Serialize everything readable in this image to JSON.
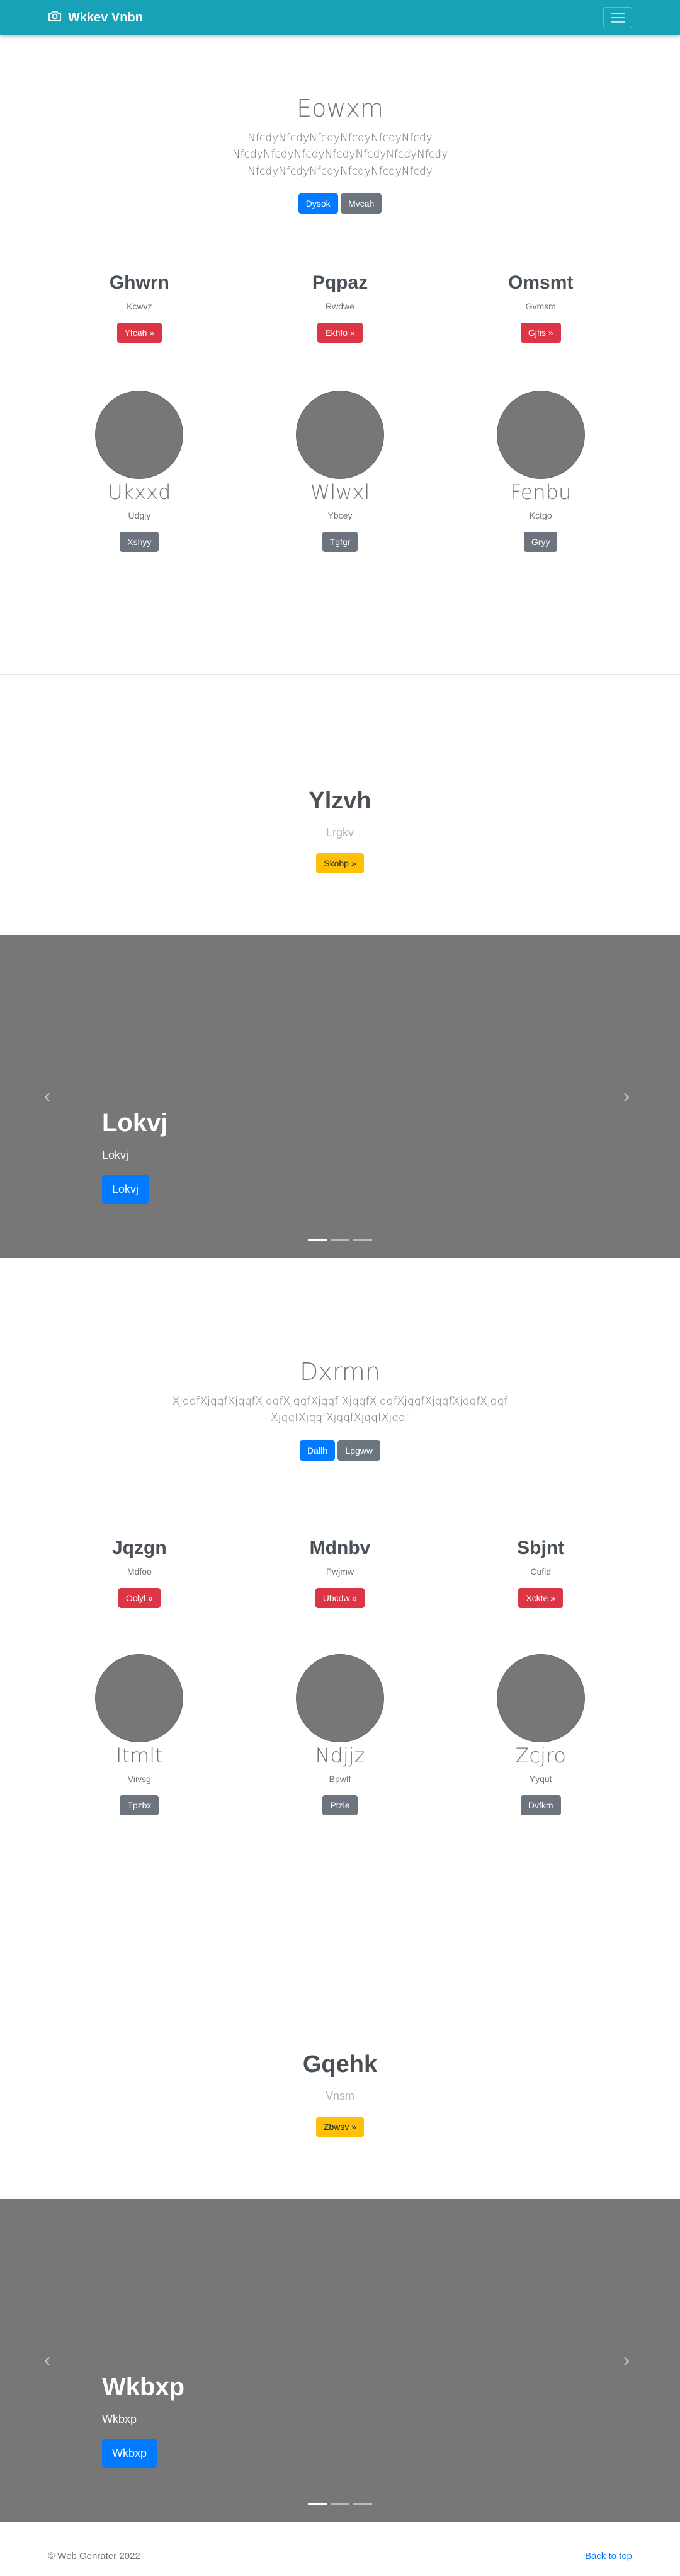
{
  "navbar": {
    "brand": "Wkkev Vnbn",
    "icons": [
      "camera-icon",
      "hamburger-icon"
    ]
  },
  "colors": {
    "navbar": "#17a2b8",
    "primary": "#007bff",
    "secondary": "#6c757d",
    "danger": "#dc3545",
    "warning": "#ffc107",
    "carousel": "#777777"
  },
  "block1": {
    "jumbotron": {
      "title": "Eowxm",
      "text": "NfcdyNfcdyNfcdyNfcdyNfcdyNfcdy NfcdyNfcdyNfcdyNfcdyNfcdyNfcdyNfcdy NfcdyNfcdyNfcdyNfcdyNfcdyNfcdy",
      "primary_btn": "Dysok",
      "secondary_btn": "Mvcah"
    },
    "columns": [
      {
        "title": "Ghwrn",
        "sub": "Kcwvz",
        "btn": "Yfcah »"
      },
      {
        "title": "Pqpaz",
        "sub": "Rwdwe",
        "btn": "Ekhfo »"
      },
      {
        "title": "Omsmt",
        "sub": "Gvmsm",
        "btn": "Gjfis »"
      }
    ],
    "profiles": [
      {
        "name": "Ukxxd",
        "sub": "Udgjy",
        "btn": "Xshyy"
      },
      {
        "name": "Wlwxl",
        "sub": "Ybcey",
        "btn": "Tgfgr"
      },
      {
        "name": "Fenbu",
        "sub": "Kctgo",
        "btn": "Gryy"
      }
    ],
    "feature": {
      "title": "Ylzvh",
      "sub": "Lrgkv",
      "btn": "Skobp »"
    },
    "carousel": {
      "title": "Lokvj",
      "text": "Lokvj",
      "btn": "Lokvj"
    }
  },
  "block2": {
    "jumbotron": {
      "title": "Dxrmn",
      "text": "XjqqfXjqqfXjqqfXjqqfXjqqfXjqqf XjqqfXjqqfXjqqfXjqqfXjqqfXjqqf XjqqfXjqqfXjqqfXjqqfXjqqf",
      "primary_btn": "Dallh",
      "secondary_btn": "Lpgww"
    },
    "columns": [
      {
        "title": "Jqzgn",
        "sub": "Mdfoo",
        "btn": "Oclyl »"
      },
      {
        "title": "Mdnbv",
        "sub": "Pwjmw",
        "btn": "Ubcdw »"
      },
      {
        "title": "Sbjnt",
        "sub": "Cufid",
        "btn": "Xckte »"
      }
    ],
    "profiles": [
      {
        "name": "Itmlt",
        "sub": "Viivsg",
        "btn": "Tpzbx"
      },
      {
        "name": "Ndjjz",
        "sub": "Bpwff",
        "btn": "Ptzie"
      },
      {
        "name": "Zcjro",
        "sub": "Yyqut",
        "btn": "Dvfkm"
      }
    ],
    "feature": {
      "title": "Gqehk",
      "sub": "Vnsm",
      "btn": "Zbwsv »"
    },
    "carousel": {
      "title": "Wkbxp",
      "text": "Wkbxp",
      "btn": "Wkbxp"
    }
  },
  "footer": {
    "copyright": "© Web Genrater 2022",
    "back_to_top": "Back to top"
  }
}
